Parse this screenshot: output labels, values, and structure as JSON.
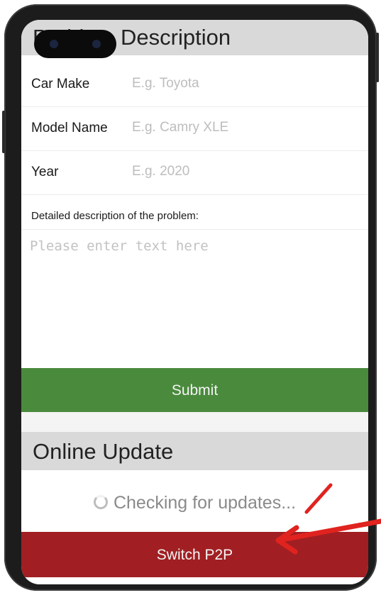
{
  "problem_section": {
    "title": "Problem Description",
    "fields": [
      {
        "label": "Car Make",
        "placeholder": "E.g. Toyota"
      },
      {
        "label": "Model Name",
        "placeholder": "E.g. Camry XLE"
      },
      {
        "label": "Year",
        "placeholder": "E.g. 2020"
      }
    ],
    "description_label": "Detailed description of the problem:",
    "description_placeholder": "Please enter text here",
    "submit_label": "Submit"
  },
  "update_section": {
    "title": "Online Update",
    "status_text": "Checking for updates...",
    "switch_label": "Switch P2P"
  },
  "colors": {
    "submit": "#4a8a3d",
    "switch": "#a11f22",
    "annotation_arrow": "#e0231f",
    "header_bg": "#d9d9d9"
  },
  "icons": {
    "spinner": "loading-spinner-icon",
    "annotation": "red-arrow-icon"
  }
}
